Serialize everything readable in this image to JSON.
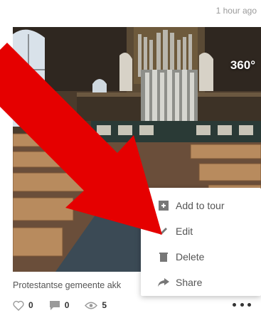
{
  "timestamp": "1 hour ago",
  "panorama": {
    "badge": "360°",
    "caption": "Protestantse gemeente akk"
  },
  "stats": {
    "likes": "0",
    "comments": "0",
    "views": "5"
  },
  "menu": {
    "items": [
      {
        "label": "Add to tour",
        "icon": "add-to-tour-icon"
      },
      {
        "label": "Edit",
        "icon": "pencil-icon"
      },
      {
        "label": "Delete",
        "icon": "trash-icon"
      },
      {
        "label": "Share",
        "icon": "share-arrow-icon"
      }
    ]
  },
  "colors": {
    "arrow": "#e50000",
    "menu_text": "#555555",
    "timestamp": "#9a9a9a"
  }
}
